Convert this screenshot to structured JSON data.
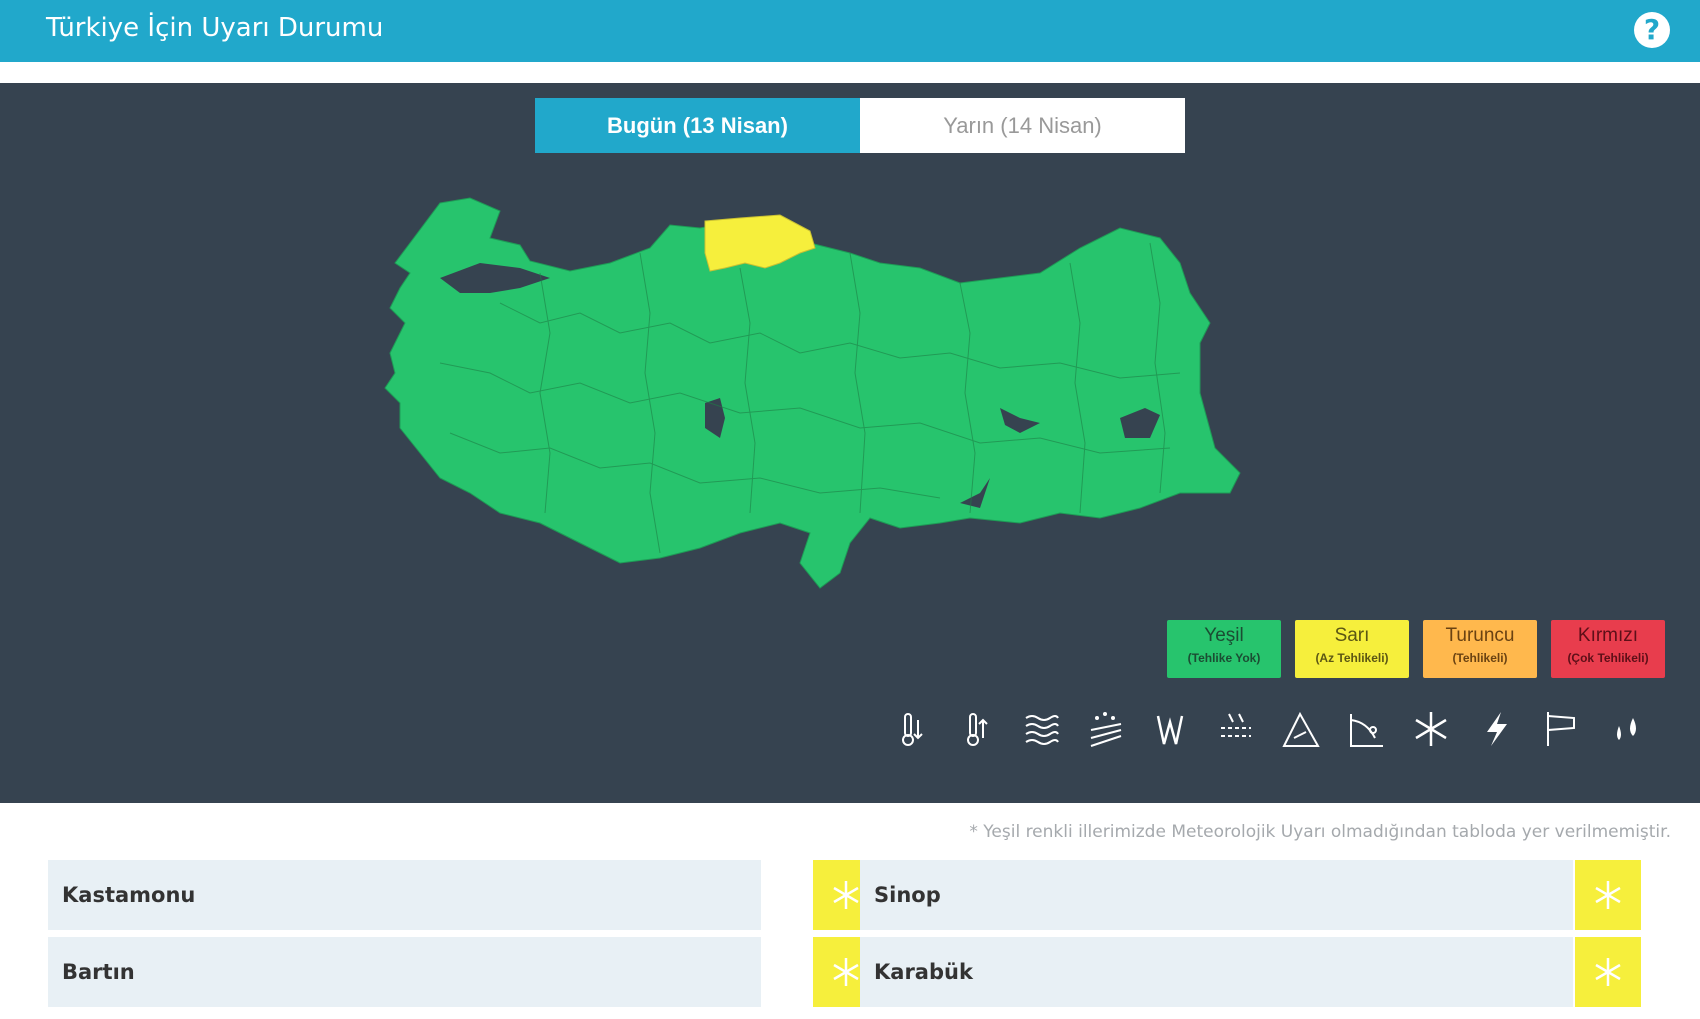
{
  "header": {
    "title": "Türkiye İçin Uyarı Durumu",
    "help_icon": "question-icon",
    "help_label": "?"
  },
  "tabs": [
    {
      "label": "Bugün (13 Nisan)",
      "active": true
    },
    {
      "label": "Yarın (14 Nisan)",
      "active": false
    }
  ],
  "legend": [
    {
      "label": "Yeşil",
      "sub": "(Tehlike Yok)",
      "color": "#27c46d"
    },
    {
      "label": "Sarı",
      "sub": "(Az Tehlikeli)",
      "color": "#f6ef3c"
    },
    {
      "label": "Turuncu",
      "sub": "(Tehlikeli)",
      "color": "#ffb84d"
    },
    {
      "label": "Kırmızı",
      "sub": "(Çok Tehlikeli)",
      "color": "#e83d4d"
    }
  ],
  "hazard_icons": [
    "cold-icon",
    "heat-icon",
    "fog-icon",
    "dust-icon",
    "wind-icon",
    "rain-snow-icon",
    "avalanche-icon",
    "landslide-icon",
    "snow-icon",
    "lightning-icon",
    "wind-flag-icon",
    "rain-icon"
  ],
  "note": "* Yeşil renkli illerimizde Meteorolojik Uyarı olmadığından tabloda yer verilmemiştir.",
  "warnings": [
    {
      "province": "Kastamonu",
      "icon": "snowflake-icon"
    },
    {
      "province": "Sinop",
      "icon": "snowflake-icon"
    },
    {
      "province": "Bartın",
      "icon": "snowflake-icon"
    },
    {
      "province": "Karabük",
      "icon": "snowflake-icon"
    }
  ],
  "colors": {
    "accent": "#21a8cb",
    "panel": "#364350",
    "green": "#27c46d",
    "yellow": "#f6ef3c"
  }
}
